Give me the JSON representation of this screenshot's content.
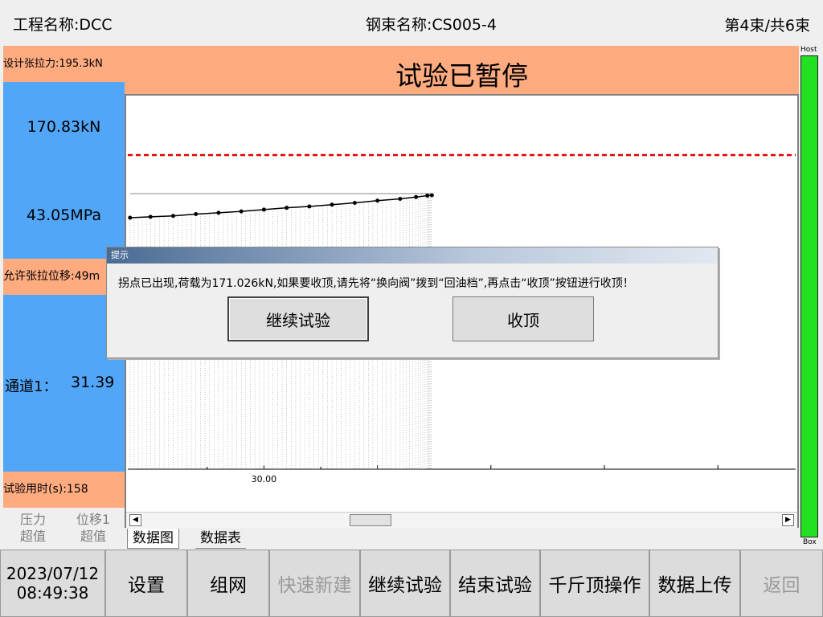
{
  "header": {
    "project": "工程名称:DCC",
    "strand": "钢束名称:CS005-4",
    "count": "第4束/共6束"
  },
  "left_panel": {
    "design_force": "设计张拉力:195.3kN",
    "force_value": "170.83kN",
    "stress_value": "43.05MPa",
    "allow_disp": "允许张拉位移:49m",
    "channel_label": "通道1：",
    "channel_value": "31.39",
    "elapsed": "试验用时(s):158",
    "pressure_label": "压力",
    "pressure_state": "超值",
    "disp_label": "位移1",
    "disp_state": "超值"
  },
  "status_banner": "试验已暂停",
  "chart_data": {
    "type": "line",
    "title": "",
    "xlabel": "",
    "ylabel": "",
    "x_tick_labels": [
      "30.00"
    ],
    "reference_line": {
      "style": "dashed",
      "color": "#e00000"
    },
    "series": [
      {
        "values": [
          [
            24.1,
            0.0
          ],
          [
            25.0,
            0.02
          ],
          [
            26.0,
            0.04
          ],
          [
            27.0,
            0.08
          ],
          [
            28.0,
            0.11
          ],
          [
            29.0,
            0.14
          ],
          [
            30.0,
            0.18
          ],
          [
            31.0,
            0.22
          ],
          [
            32.0,
            0.25
          ],
          [
            33.0,
            0.29
          ],
          [
            34.0,
            0.33
          ],
          [
            35.0,
            0.38
          ],
          [
            36.0,
            0.42
          ],
          [
            36.7,
            0.46
          ],
          [
            37.2,
            0.49
          ],
          [
            37.4,
            0.5
          ]
        ]
      }
    ]
  },
  "tabs": [
    "数据图",
    "数据表"
  ],
  "progress": {
    "top_label": "Host",
    "bottom_label": "Box",
    "fill_fraction": 1.0,
    "color": "#22e022"
  },
  "toolbar": {
    "date": "2023/07/12",
    "time": "08:49:38",
    "buttons": [
      "设置",
      "组网",
      "快速新建",
      "继续试验",
      "结束试验",
      "千斤顶操作",
      "数据上传",
      "返回"
    ]
  },
  "dialog": {
    "title": "提示",
    "message": "拐点已出现,荷载为171.026kN,如果要收顶,请先将“换向阀”拨到“回油档”,再点击“收顶”按钮进行收顶！",
    "continue_label": "继续试验",
    "retract_label": "收顶"
  },
  "colors": {
    "accent_orange": "#ffab80",
    "accent_blue": "#52a6f8",
    "progress_green": "#22e022",
    "limit_red": "#e00000"
  },
  "icons": {
    "scroll_left": "triangle-left-icon",
    "scroll_right": "triangle-right-icon"
  }
}
